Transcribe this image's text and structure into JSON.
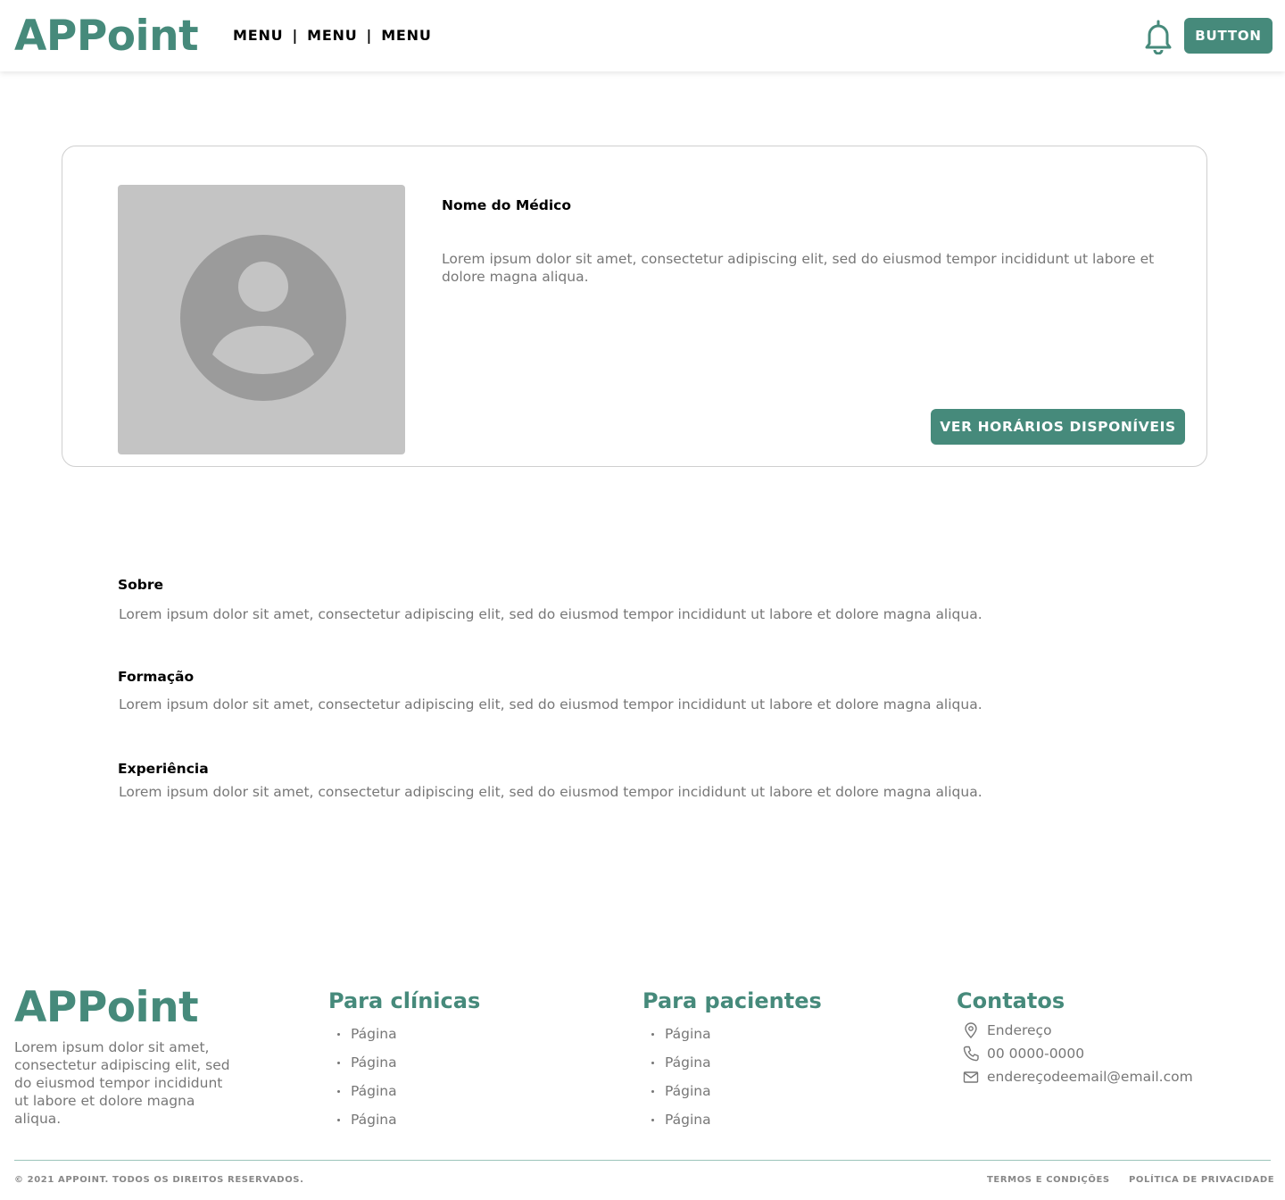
{
  "header": {
    "logo": "APPoint",
    "menu": [
      "MENU",
      "MENU",
      "MENU"
    ],
    "separator": "|",
    "notification_icon": "bell-icon",
    "button_label": "BUTTON"
  },
  "doctor_card": {
    "name": "Nome do Médico",
    "description": "Lorem ipsum dolor sit amet, consectetur adipiscing elit, sed do eiusmod tempor incididunt ut labore et dolore magna aliqua.",
    "photo_icon": "user-avatar-placeholder-icon",
    "cta_label": "VER HORÁRIOS DISPONÍVEIS"
  },
  "sections": [
    {
      "title": "Sobre",
      "text": "Lorem ipsum dolor sit amet, consectetur adipiscing elit, sed do eiusmod tempor incididunt ut labore et dolore magna aliqua."
    },
    {
      "title": "Formação",
      "text": "Lorem ipsum dolor sit amet, consectetur adipiscing elit, sed do eiusmod tempor incididunt ut labore et dolore magna aliqua."
    },
    {
      "title": "Experiência",
      "text": "Lorem ipsum dolor sit amet, consectetur adipiscing elit, sed do eiusmod tempor incididunt ut labore et dolore magna aliqua."
    }
  ],
  "footer": {
    "logo": "APPoint",
    "about": "Lorem ipsum dolor sit amet, consectetur adipiscing elit, sed do eiusmod tempor incididunt ut labore et dolore magna aliqua.",
    "clinics": {
      "title": "Para clínicas",
      "links": [
        "Página",
        "Página",
        "Página",
        "Página"
      ]
    },
    "patients": {
      "title": "Para pacientes",
      "links": [
        "Página",
        "Página",
        "Página",
        "Página"
      ]
    },
    "contacts": {
      "title": "Contatos",
      "address": "Endereço",
      "phone": "00 0000-0000",
      "email": "endereçodeemail@email.com",
      "icons": [
        "map-pin-icon",
        "phone-icon",
        "mail-icon"
      ]
    },
    "copyright": "© 2021 APPOINT. TODOS OS DIREITOS RESERVADOS.",
    "terms": "TERMOS E CONDIÇÕES",
    "privacy": "POLÍTICA DE PRIVACIDADE"
  },
  "colors": {
    "brand": "#468a7b",
    "muted_text": "#777777",
    "placeholder_bg": "#c4c4c4",
    "placeholder_fg": "#9b9b9b"
  }
}
